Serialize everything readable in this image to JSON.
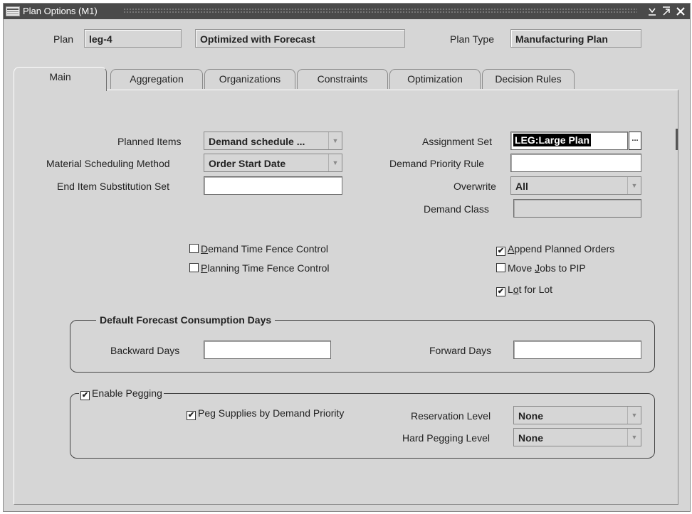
{
  "window": {
    "title": "Plan Options (M1)",
    "controls": [
      "∨",
      "↗",
      "✕"
    ]
  },
  "header": {
    "plan_label": "Plan",
    "plan_value": "leg-4",
    "plan_description": "Optimized with Forecast",
    "plan_type_label": "Plan Type",
    "plan_type_value": "Manufacturing Plan"
  },
  "tabs": [
    {
      "label": "Main",
      "active": true
    },
    {
      "label": "Aggregation",
      "active": false
    },
    {
      "label": "Organizations",
      "active": false
    },
    {
      "label": "Constraints",
      "active": false
    },
    {
      "label": "Optimization",
      "active": false
    },
    {
      "label": "Decision Rules",
      "active": false
    }
  ],
  "main": {
    "planned_items_label": "Planned Items",
    "planned_items_value": "Demand schedule ...",
    "material_method_label": "Material Scheduling Method",
    "material_method_value": "Order Start Date",
    "end_item_label": "End Item Substitution Set",
    "end_item_value": "",
    "assignment_set_label": "Assignment Set",
    "assignment_set_value": "LEG:Large Plan",
    "lov_button": "...",
    "demand_priority_label": "Demand Priority Rule",
    "demand_priority_value": "",
    "overwrite_label": "Overwrite",
    "overwrite_value": "All",
    "demand_class_label": "Demand Class",
    "demand_class_value": ""
  },
  "checkboxes": {
    "demand_time_fence": {
      "prefix": "",
      "mnemonic": "D",
      "rest": "emand Time Fence Control",
      "checked": false
    },
    "planning_time_fence": {
      "prefix": "",
      "mnemonic": "P",
      "rest": "lanning Time Fence Control",
      "checked": false
    },
    "append_planned_orders": {
      "prefix": "",
      "mnemonic": "A",
      "rest": "ppend Planned Orders",
      "checked": true
    },
    "move_jobs_to_pip": {
      "prefix": "Move ",
      "mnemonic": "J",
      "rest": "obs to PIP",
      "checked": false
    },
    "lot_for_lot": {
      "prefix": "L",
      "mnemonic": "o",
      "rest": "t for Lot",
      "checked": true
    }
  },
  "forecast_group": {
    "title": "Default Forecast Consumption Days",
    "backward_label": "Backward Days",
    "backward_value": "",
    "forward_label": "Forward Days",
    "forward_value": ""
  },
  "pegging_group": {
    "enable_label": "Enable Pegging",
    "enable_checked": true,
    "peg_supplies_label": "Peg Supplies by Demand Priority",
    "peg_supplies_checked": true,
    "reservation_label": "Reservation Level",
    "reservation_value": "None",
    "hard_pegging_label": "Hard Pegging Level",
    "hard_pegging_value": "None"
  },
  "glyphs": {
    "checked": "✔",
    "dropdown_arrow": "▼"
  }
}
